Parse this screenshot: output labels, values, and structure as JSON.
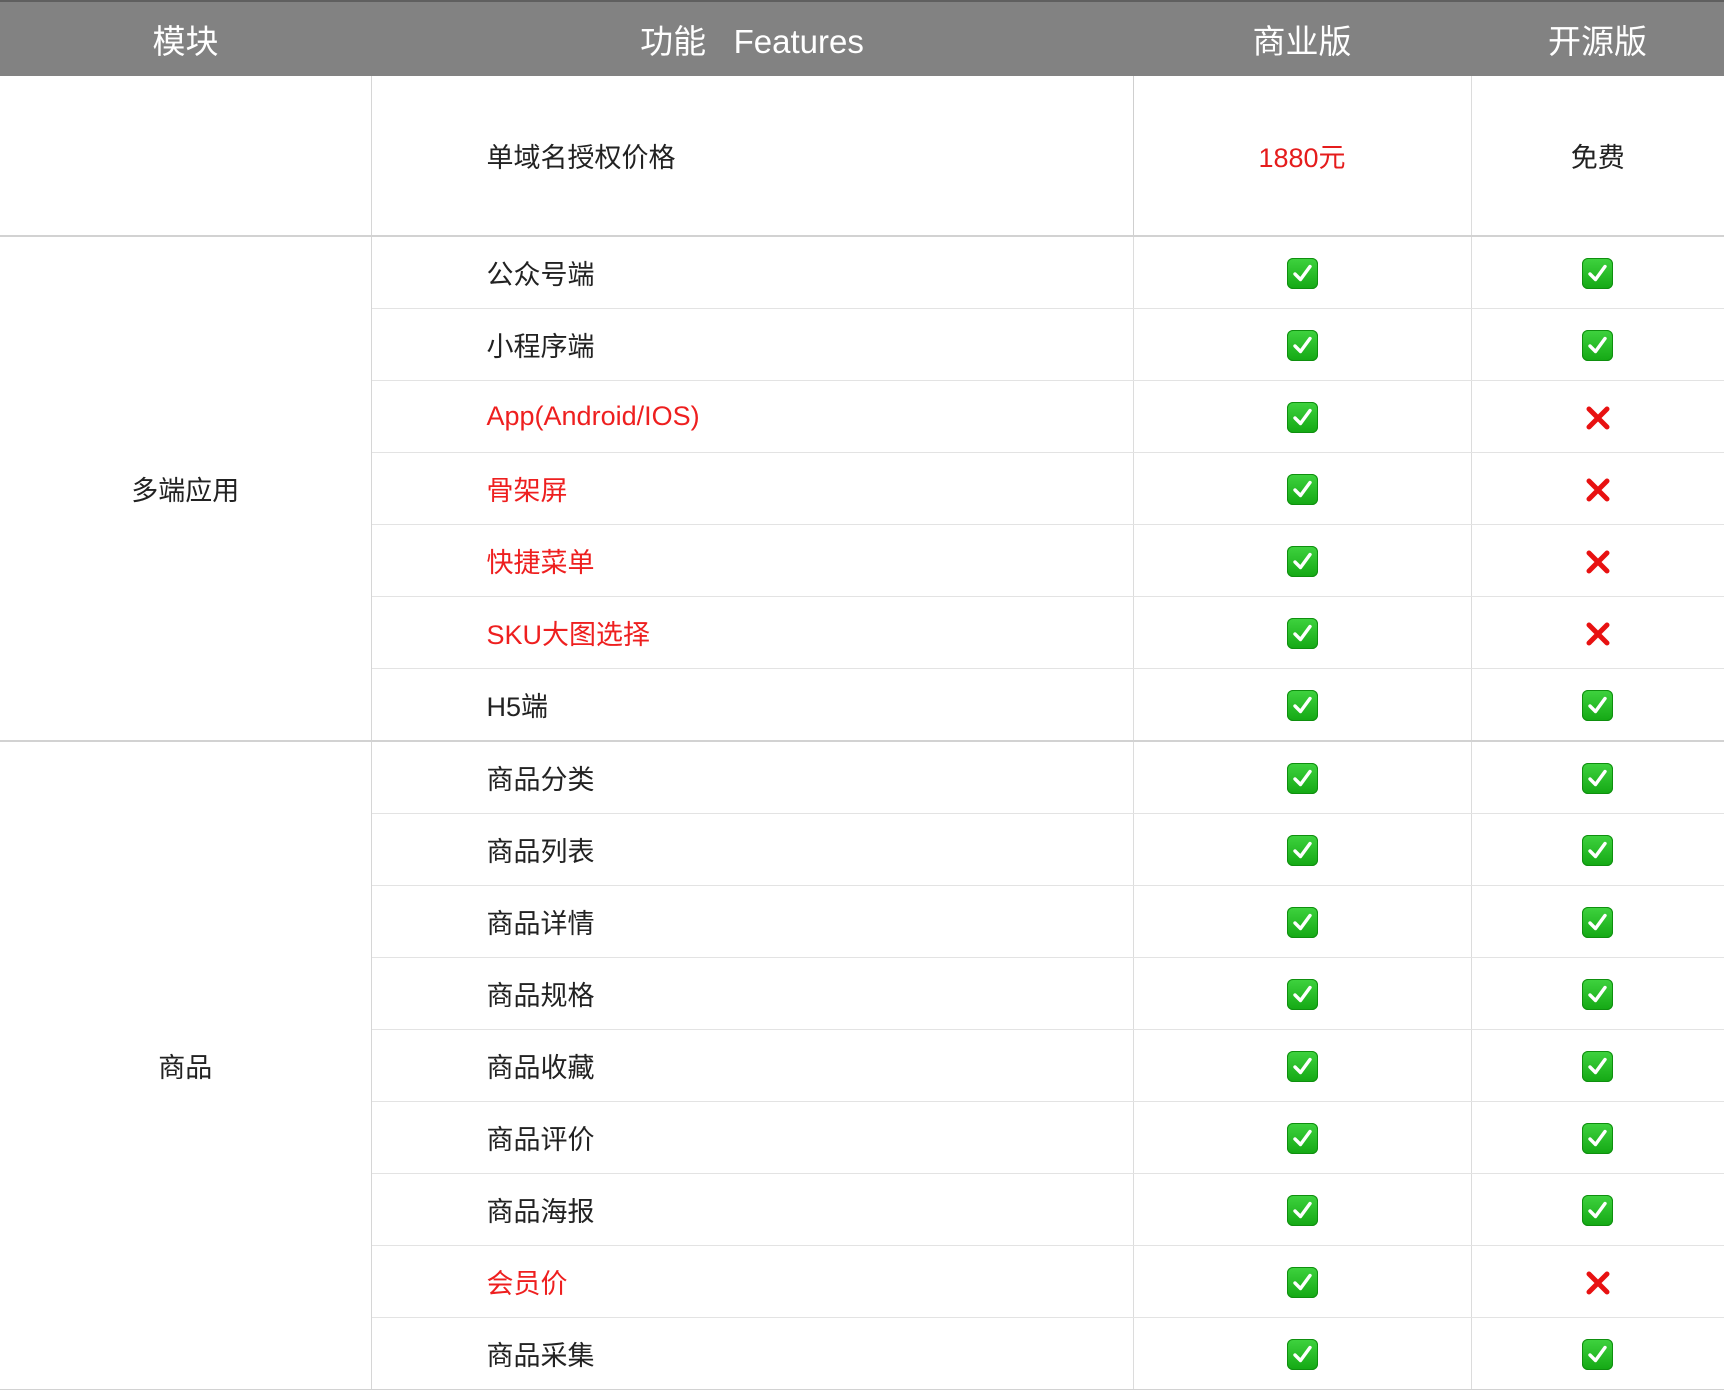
{
  "header": {
    "module": "模块",
    "feature": "功能   Features",
    "commercial": "商业版",
    "open_source": "开源版"
  },
  "price_row": {
    "feature": "单域名授权价格",
    "commercial": "1880元",
    "open_source": "免费"
  },
  "groups": [
    {
      "module": "多端应用",
      "rows": [
        {
          "feature": "公众号端",
          "highlight": false,
          "commercial": "check",
          "open_source": "check"
        },
        {
          "feature": "小程序端",
          "highlight": false,
          "commercial": "check",
          "open_source": "check"
        },
        {
          "feature": "App(Android/IOS)",
          "highlight": true,
          "commercial": "check",
          "open_source": "cross"
        },
        {
          "feature": "骨架屏",
          "highlight": true,
          "commercial": "check",
          "open_source": "cross"
        },
        {
          "feature": "快捷菜单",
          "highlight": true,
          "commercial": "check",
          "open_source": "cross"
        },
        {
          "feature": "SKU大图选择",
          "highlight": true,
          "commercial": "check",
          "open_source": "cross"
        },
        {
          "feature": "H5端",
          "highlight": false,
          "commercial": "check",
          "open_source": "check"
        }
      ]
    },
    {
      "module": "商品",
      "rows": [
        {
          "feature": "商品分类",
          "highlight": false,
          "commercial": "check",
          "open_source": "check"
        },
        {
          "feature": "商品列表",
          "highlight": false,
          "commercial": "check",
          "open_source": "check"
        },
        {
          "feature": "商品详情",
          "highlight": false,
          "commercial": "check",
          "open_source": "check"
        },
        {
          "feature": "商品规格",
          "highlight": false,
          "commercial": "check",
          "open_source": "check"
        },
        {
          "feature": "商品收藏",
          "highlight": false,
          "commercial": "check",
          "open_source": "check"
        },
        {
          "feature": "商品评价",
          "highlight": false,
          "commercial": "check",
          "open_source": "check"
        },
        {
          "feature": "商品海报",
          "highlight": false,
          "commercial": "check",
          "open_source": "check"
        },
        {
          "feature": "会员价",
          "highlight": true,
          "commercial": "check",
          "open_source": "cross"
        },
        {
          "feature": "商品采集",
          "highlight": false,
          "commercial": "check",
          "open_source": "check"
        }
      ]
    }
  ],
  "colors": {
    "header_bg": "#828282",
    "highlight_text": "#ee1f1f",
    "check_green": "#1fbf1f",
    "cross_red": "#e81111"
  },
  "icons": {
    "check": "check-icon",
    "cross": "cross-icon"
  }
}
